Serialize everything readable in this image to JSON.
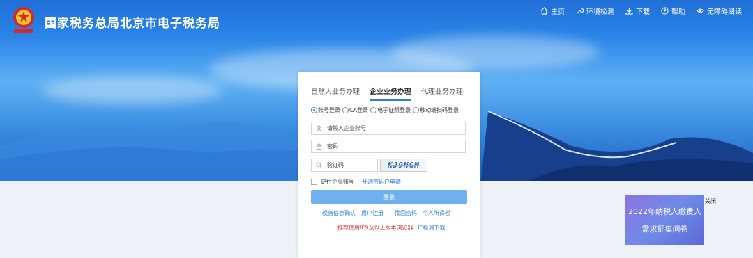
{
  "header": {
    "site_title": "国家税务总局北京市电子税务局",
    "nav": [
      {
        "label": "主页",
        "icon": "home-icon"
      },
      {
        "label": "环境检测",
        "icon": "wrench-icon"
      },
      {
        "label": "下载",
        "icon": "download-icon"
      },
      {
        "label": "帮助",
        "icon": "help-icon"
      },
      {
        "label": "无障碍阅读",
        "icon": "eye-icon"
      }
    ]
  },
  "login": {
    "tabs": [
      "自然人业务办理",
      "企业业务办理",
      "代理业务办理"
    ],
    "active_tab": "企业业务办理",
    "methods": [
      "账号登录",
      "CA登录",
      "电子证照登录",
      "移动端扫码登录"
    ],
    "selected_method": "账号登录",
    "account_placeholder": "请输入企业账号",
    "password_placeholder": "密码",
    "captcha_placeholder": "验证码",
    "captcha_text": "KJ9NGM",
    "remember_label": "记住企业账号",
    "apply_link": "开通密码户申请",
    "login_button": "登录",
    "links": [
      "税务信息确认",
      "用户注册",
      "找回密码",
      "个人所得税"
    ],
    "recommend_text": "推荐使用IE9及以上版本浏览器",
    "ie_check_link": "IE检测下载"
  },
  "survey": {
    "line1": "2022年纳税人缴费人",
    "line2": "需求征集问卷",
    "close_label": "关闭"
  },
  "colors": {
    "primary": "#2d7be0",
    "login_button": "#6fb1f0",
    "warning": "#e53935"
  }
}
